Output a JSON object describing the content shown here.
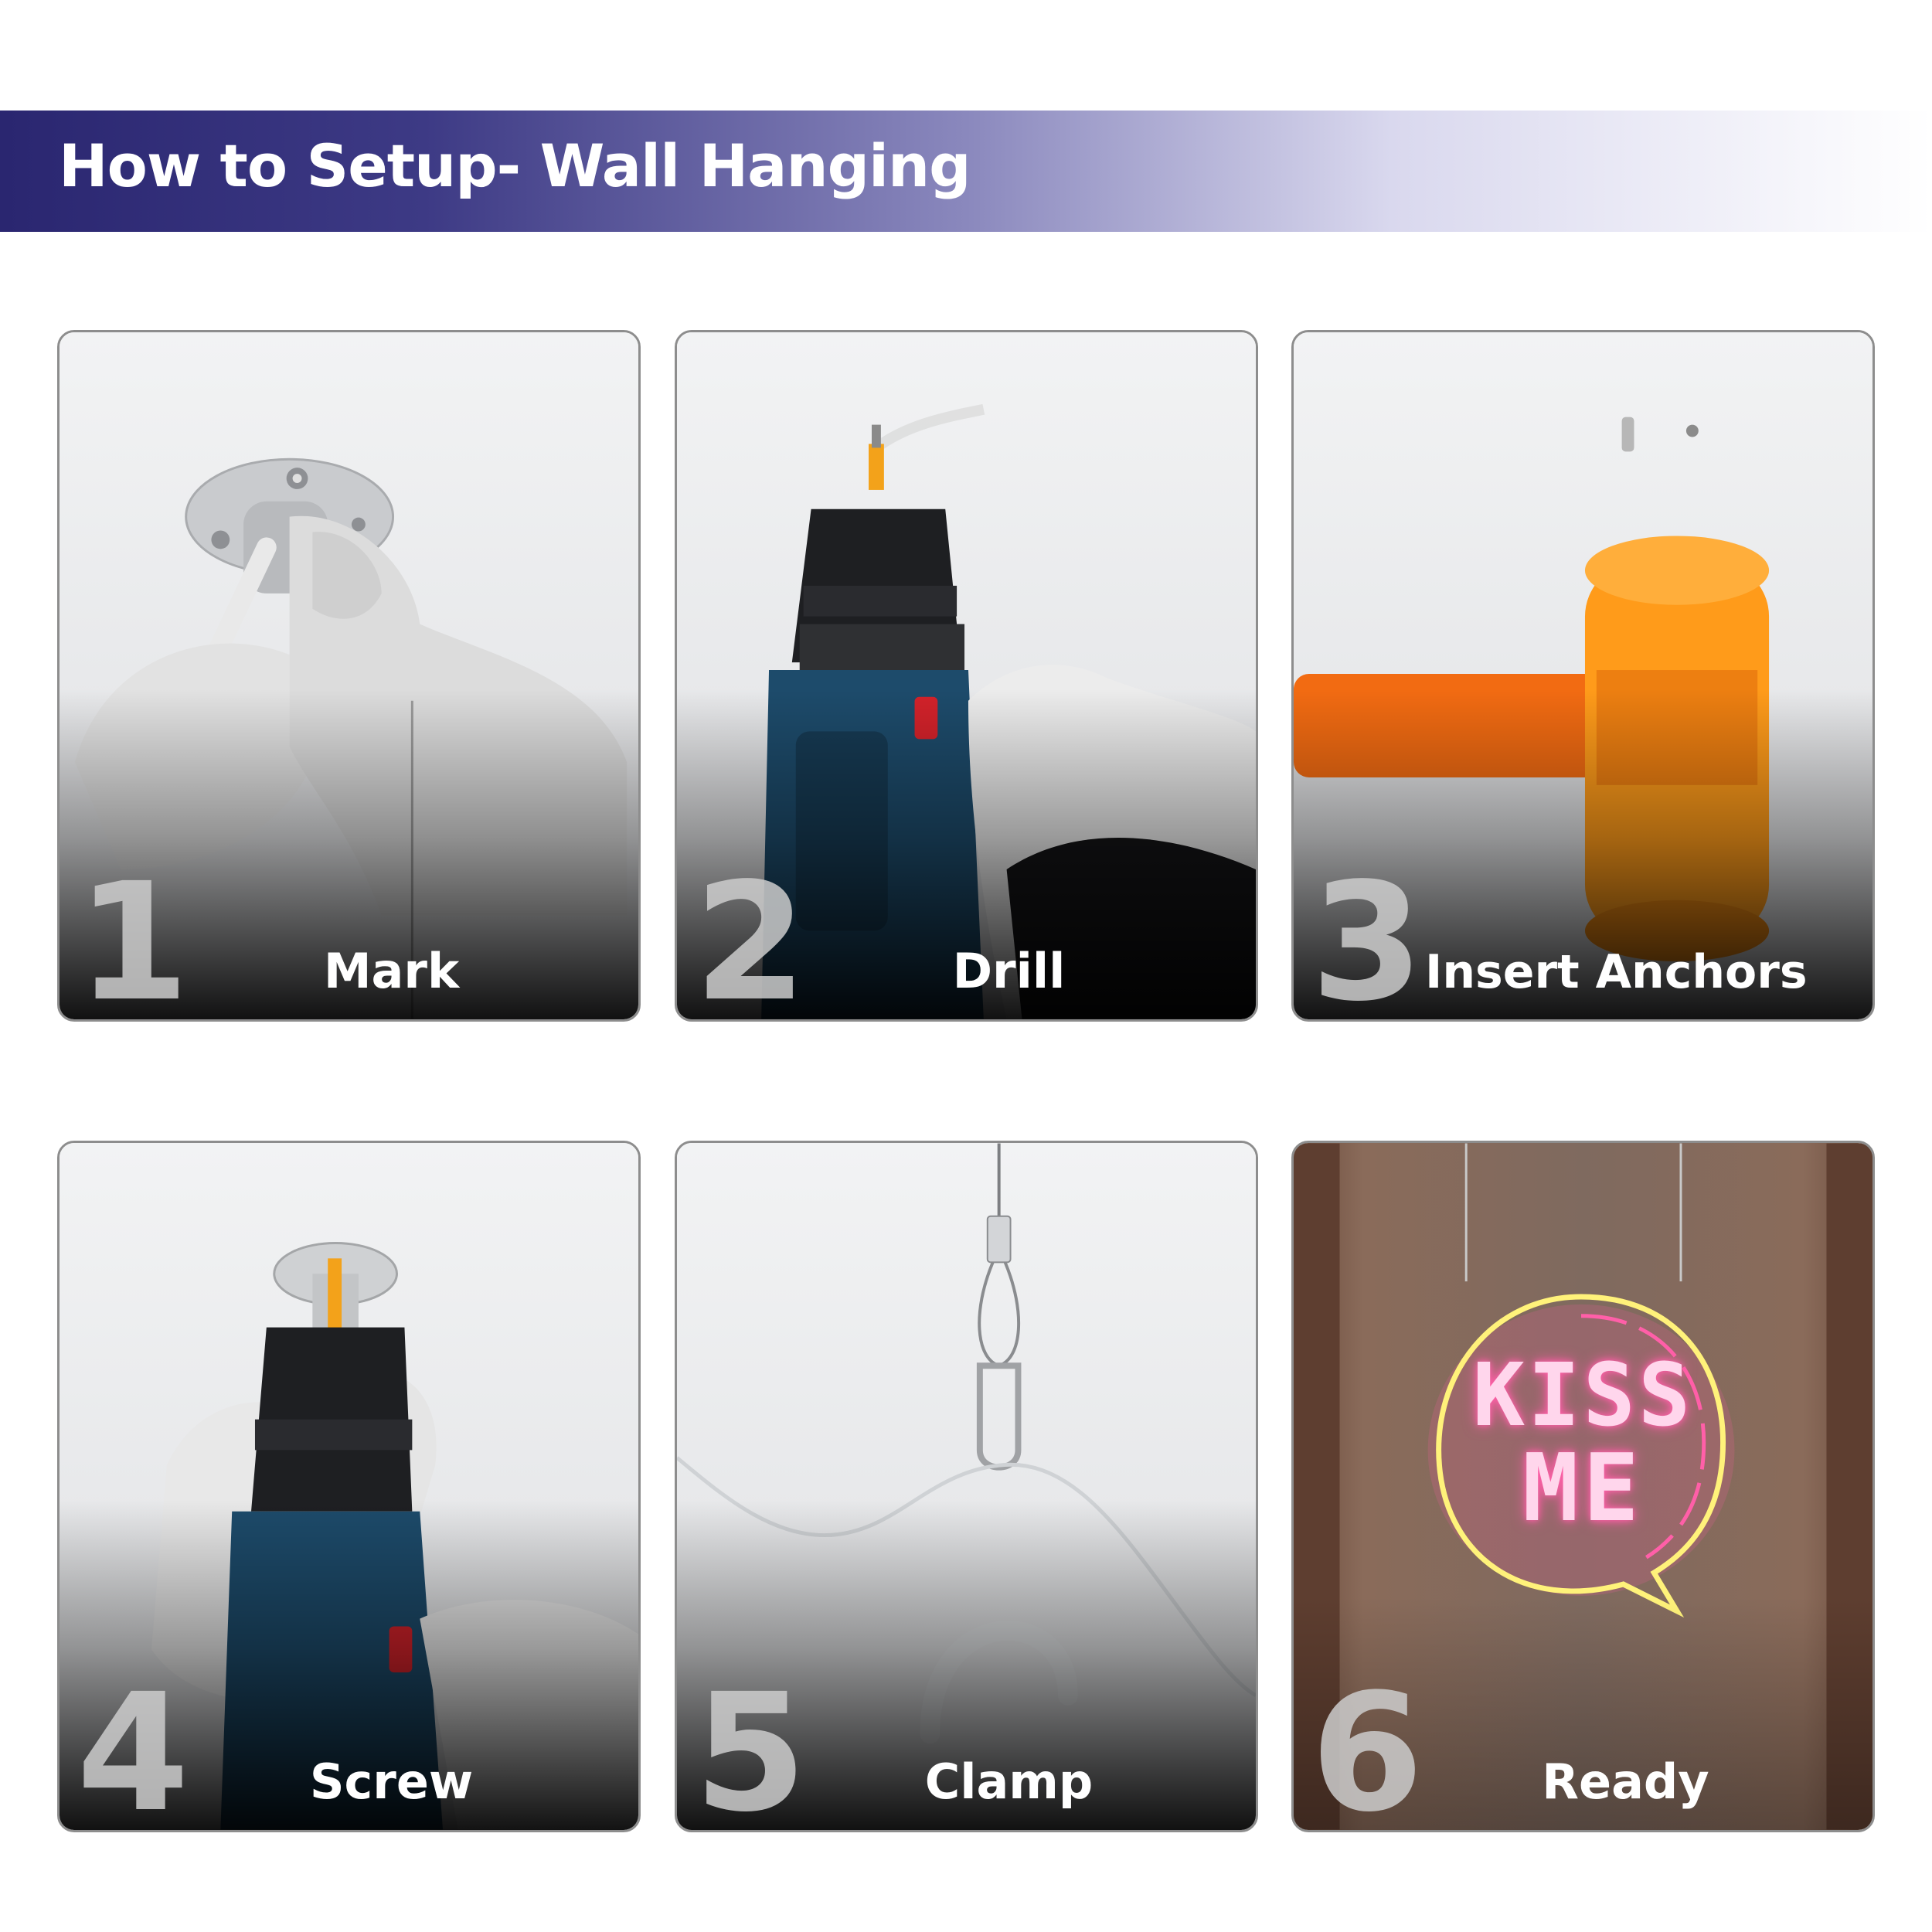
{
  "header": {
    "title": "How to Setup- Wall Hanging"
  },
  "steps": [
    {
      "number": "1",
      "label": "Mark"
    },
    {
      "number": "2",
      "label": "Drill"
    },
    {
      "number": "3",
      "label": "Insert Anchors"
    },
    {
      "number": "4",
      "label": "Screw"
    },
    {
      "number": "5",
      "label": "Clamp"
    },
    {
      "number": "6",
      "label": "Ready"
    }
  ],
  "sign": {
    "line1": "KISS",
    "line2": "ME"
  },
  "colors": {
    "header_dark": "#2a2670",
    "neon_pink": "#ff5fa8",
    "neon_yellow": "#fff27a",
    "mallet_orange": "#ff7a10",
    "drill_blue": "#1d4b6b"
  }
}
